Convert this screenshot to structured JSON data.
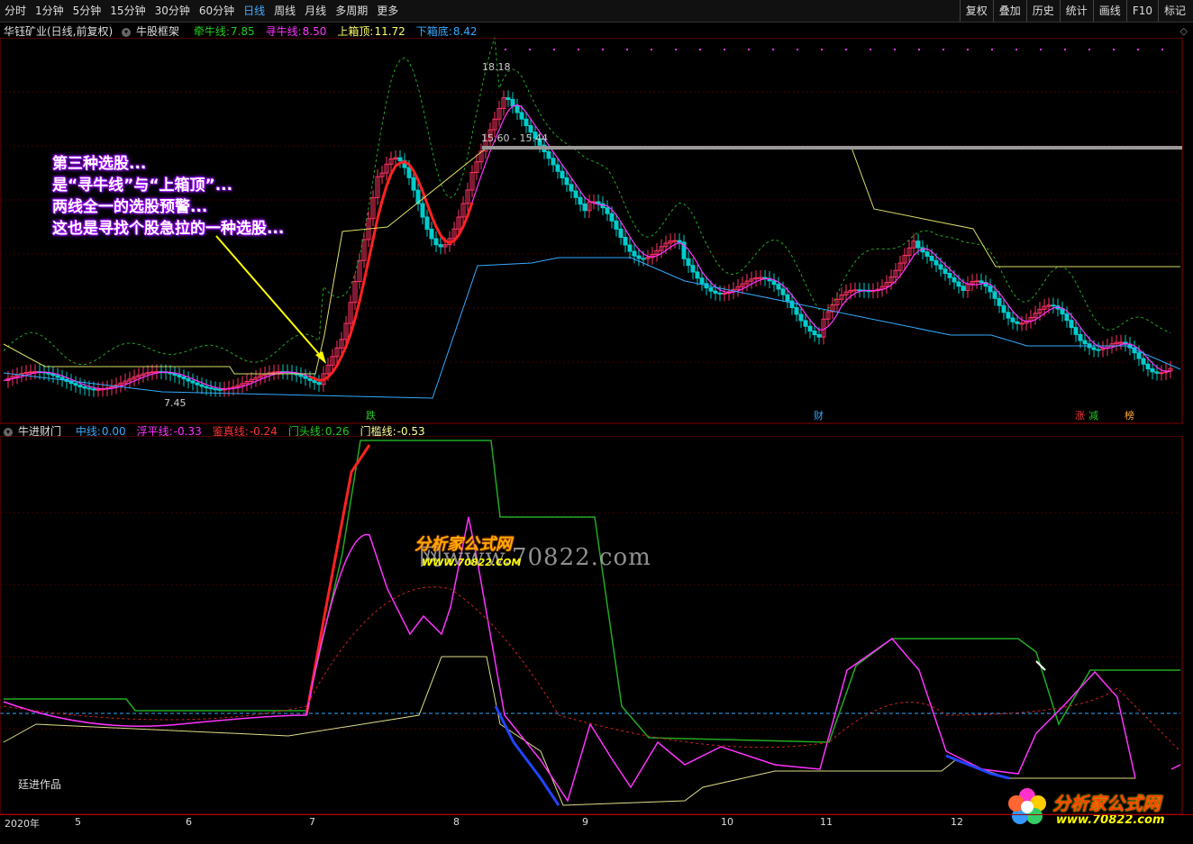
{
  "toolbar": {
    "periods": [
      "分时",
      "1分钟",
      "5分钟",
      "15分钟",
      "30分钟",
      "60分钟",
      "日线",
      "周线",
      "月线",
      "多周期",
      "更多"
    ],
    "active": "日线",
    "right": [
      "复权",
      "叠加",
      "历史",
      "统计",
      "画线",
      "F10",
      "标记"
    ]
  },
  "main_legend": {
    "stock": "华钰矿业(日线,前复权)",
    "indicator": "牛股框架",
    "items": [
      {
        "label": "牵牛线:",
        "value": "7.85",
        "color": "#22cc22"
      },
      {
        "label": "寻牛线:",
        "value": "8.50",
        "color": "#ff33ff"
      },
      {
        "label": "上箱顶:",
        "value": "11.72",
        "color": "#ffff66"
      },
      {
        "label": "下箱底:",
        "value": "8.42",
        "color": "#33aaff"
      }
    ]
  },
  "sub_legend": {
    "indicator": "牛进财门",
    "items": [
      {
        "label": "中线:",
        "value": "0.00",
        "color": "#33aaff"
      },
      {
        "label": "浮平线:",
        "value": "-0.33",
        "color": "#ff33ff"
      },
      {
        "label": "鉴真线:",
        "value": "-0.24",
        "color": "#ff3333"
      },
      {
        "label": "门头线:",
        "value": "0.26",
        "color": "#22cc22"
      },
      {
        "label": "门槛线:",
        "value": "-0.53",
        "color": "#ffff99"
      }
    ]
  },
  "annotation": [
    "第三种选股...",
    "是“寻牛线”与“上箱顶”...",
    "两线全一的选股预警...",
    "这也是寻找个股急拉的一种选股..."
  ],
  "price_labels": {
    "high": "18.18",
    "range": "15.60 - 15.44",
    "low": "7.45"
  },
  "signals": [
    {
      "text": "跌",
      "color": "#22cc22"
    },
    {
      "text": "财",
      "color": "#33aaff"
    },
    {
      "text": "涨",
      "color": "#ff3333"
    },
    {
      "text": "减",
      "color": "#22cc22"
    },
    {
      "text": "榜",
      "color": "#ffaa33"
    }
  ],
  "credit": "廷进作品",
  "watermark": {
    "site": "网www.70822.com",
    "logo": "分析家公式网",
    "url": "WWW.70822.COM"
  },
  "logo_bottom": {
    "text": "分析家公式网",
    "url": "www.70822.com"
  },
  "xaxis": [
    "2020年",
    "5",
    "6",
    "7",
    "8",
    "9",
    "10",
    "11",
    "12"
  ],
  "colors": {
    "up": "#ff3366",
    "down": "#00cccc",
    "grid": "#550000"
  }
}
